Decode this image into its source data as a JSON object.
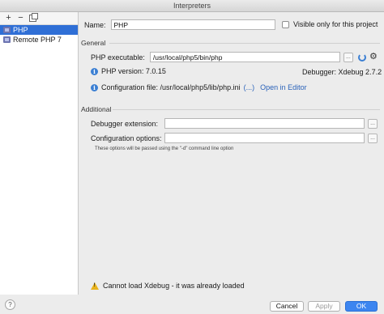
{
  "window": {
    "title": "Interpreters"
  },
  "sidebar": {
    "toolbar": {
      "add": "+",
      "remove": "−"
    },
    "items": [
      {
        "label": "PHP",
        "selected": true
      },
      {
        "label": "Remote PHP 7",
        "selected": false
      }
    ]
  },
  "form": {
    "name_label": "Name:",
    "name_value": "PHP",
    "visible_only_label": "Visible only for this project",
    "general_title": "General",
    "executable_label": "PHP executable:",
    "executable_value": "/usr/local/php5/bin/php",
    "browse": "...",
    "php_version": "PHP version: 7.0.15",
    "debugger": "Debugger: Xdebug 2.7.2",
    "config_file": "Configuration file: /usr/local/php5/lib/php.ini",
    "config_more": "(...)",
    "open_in_editor": "Open in Editor",
    "additional_title": "Additional",
    "debugger_ext_label": "Debugger extension:",
    "debugger_ext_value": "",
    "config_options_label": "Configuration options:",
    "config_options_value": "",
    "hint": "These options will be passed using the \"-d\" command line option",
    "warning": "Cannot load Xdebug - it was already loaded"
  },
  "footer": {
    "help": "?",
    "cancel": "Cancel",
    "apply": "Apply",
    "ok": "OK"
  },
  "colors": {
    "accent": "#3c85f0",
    "selection": "#2f6fd6",
    "link": "#2a62b9",
    "warning": "#e8b21b"
  }
}
